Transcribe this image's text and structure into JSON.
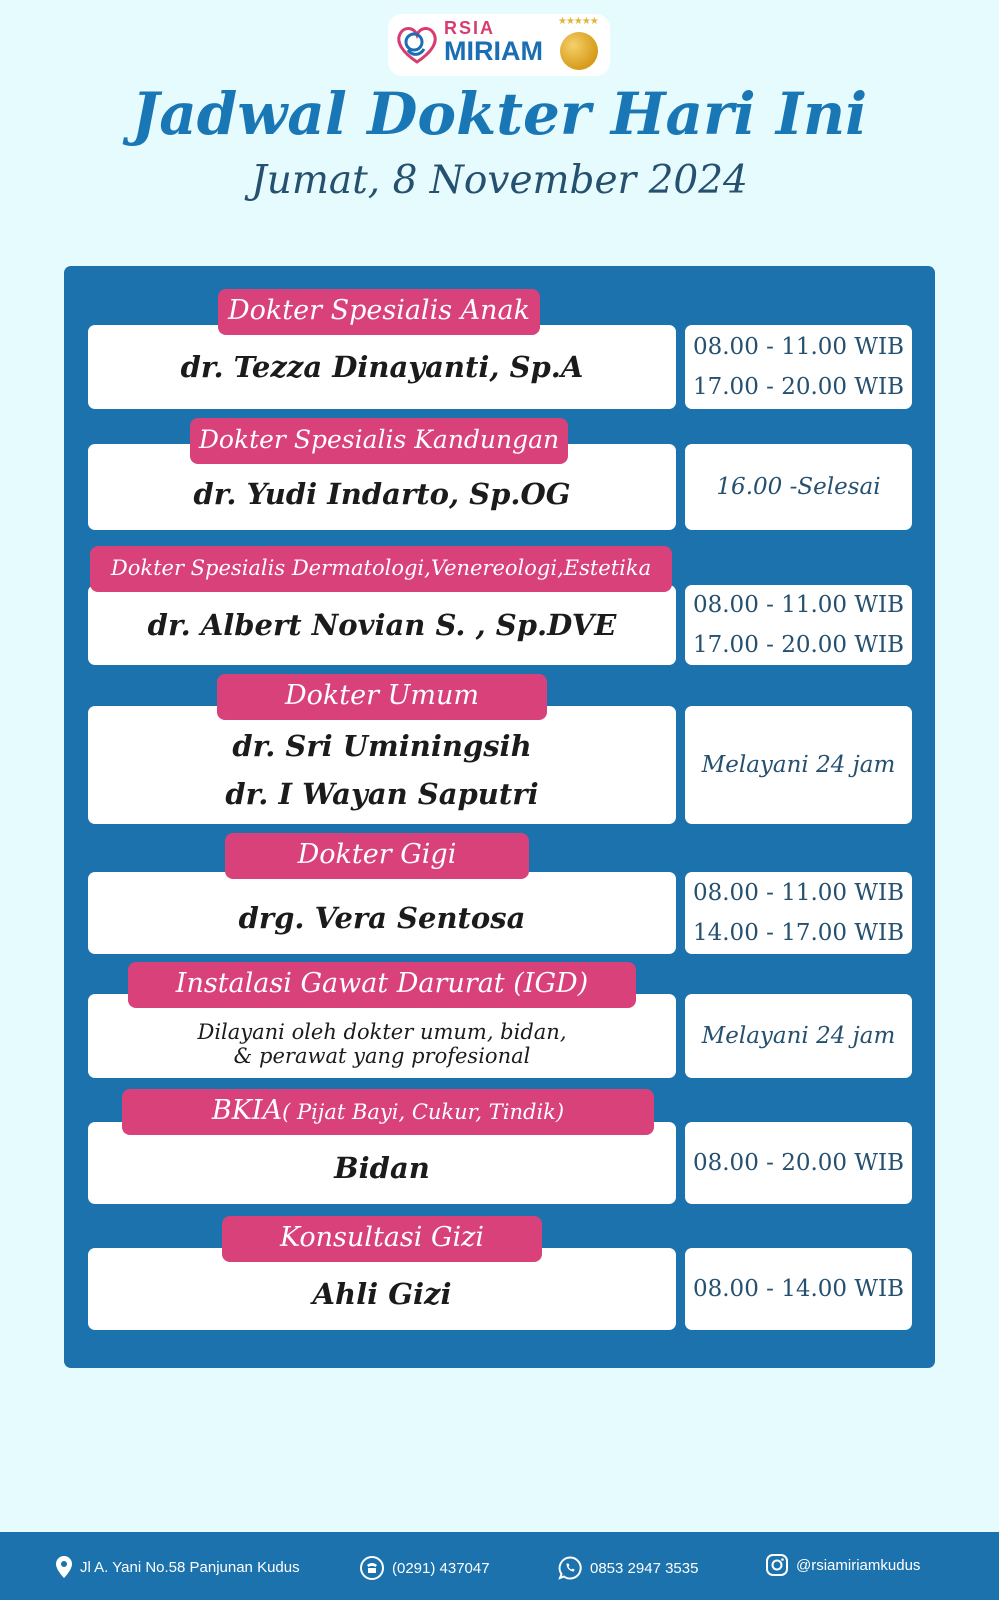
{
  "logo": {
    "line1": "RSIA",
    "line2": "MIRIAM",
    "stars": "★★★★★"
  },
  "header": {
    "title": "Jadwal Dokter Hari Ini",
    "date": "Jumat, 8 November 2024"
  },
  "sections": [
    {
      "category": "Dokter Spesialis Anak",
      "doctors": [
        "dr. Tezza Dinayanti, Sp.A"
      ],
      "times": [
        "08.00 - 11.00 WIB",
        "17.00 - 20.00 WIB"
      ]
    },
    {
      "category": "Dokter Spesialis Kandungan",
      "doctors": [
        "dr. Yudi Indarto, Sp.OG"
      ],
      "times": [
        "16.00 -Selesai"
      ]
    },
    {
      "category": "Dokter Spesialis Dermatologi,Venereologi,Estetika",
      "doctors": [
        "dr. Albert Novian S. , Sp.DVE"
      ],
      "times": [
        "08.00 - 11.00 WIB",
        "17.00 - 20.00 WIB"
      ]
    },
    {
      "category": "Dokter Umum",
      "doctors": [
        "dr. Sri Uminingsih",
        "dr. I Wayan Saputri"
      ],
      "times": [
        "Melayani 24 jam"
      ]
    },
    {
      "category": "Dokter Gigi",
      "doctors": [
        "drg. Vera Sentosa"
      ],
      "times": [
        "08.00 - 11.00 WIB",
        "14.00 - 17.00 WIB"
      ]
    },
    {
      "category": "Instalasi Gawat Darurat (IGD)",
      "doctors": [
        "Dilayani oleh dokter umum, bidan,",
        "& perawat yang profesional"
      ],
      "times": [
        "Melayani 24 jam"
      ]
    },
    {
      "category": "BKIA",
      "category_note": "( Pijat Bayi, Cukur, Tindik)",
      "doctors": [
        "Bidan"
      ],
      "times": [
        "08.00 - 20.00 WIB"
      ]
    },
    {
      "category": "Konsultasi Gizi",
      "doctors": [
        "Ahli Gizi"
      ],
      "times": [
        "08.00 - 14.00 WIB"
      ]
    }
  ],
  "footer": {
    "address": "Jl A. Yani No.58 Panjunan Kudus",
    "phone": "(0291) 437047",
    "whatsapp": "0853 2947 3535",
    "instagram": "@rsiamiriamkudus"
  },
  "colors": {
    "background": "#e6fbfd",
    "panel": "#1b72ad",
    "badge": "#d9417b",
    "title": "#1a77b6",
    "time_text": "#25506f"
  }
}
